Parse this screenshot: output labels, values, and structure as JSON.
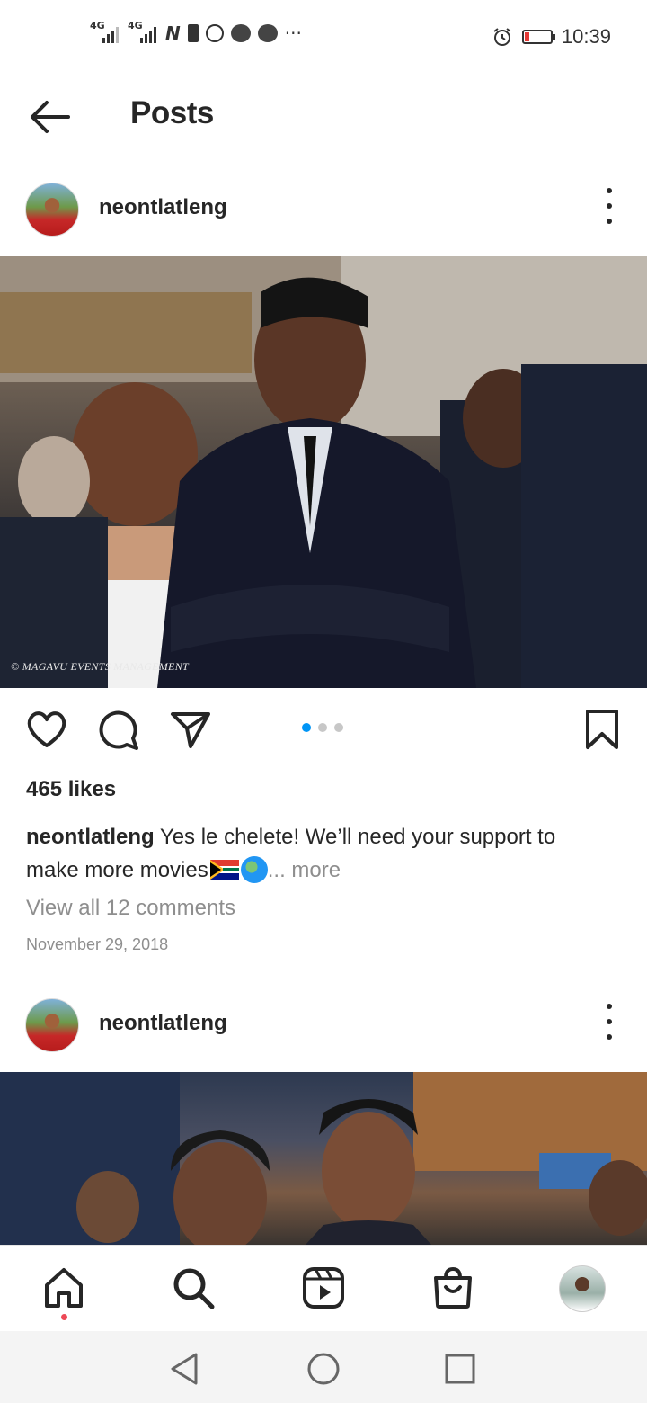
{
  "status_bar": {
    "network1": "4G",
    "network2": "4G",
    "time": "10:39",
    "icons": [
      "signal-icon",
      "signal-icon",
      "nfc-icon",
      "sim-icon",
      "whatsapp-icon",
      "chat-icon",
      "messages-icon",
      "more-notifications-icon",
      "alarm-icon",
      "battery-icon"
    ],
    "ellipsis": "···"
  },
  "header": {
    "title": "Posts",
    "back_icon": "arrow-left-icon"
  },
  "posts": [
    {
      "username": "neontlatleng",
      "watermark": "© MAGAVU EVENTS MANAGEMENT",
      "likes": "465 likes",
      "caption_user": "neontlatleng",
      "caption_text": " Yes le chelete! We’ll need your support to make more movies",
      "caption_more": "... more",
      "view_comments": "View all 12 comments",
      "date": "November 29, 2018",
      "carousel_count": 3,
      "carousel_active": 1
    },
    {
      "username": "neontlatleng"
    }
  ],
  "actions": {
    "like_icon": "heart-icon",
    "comment_icon": "comment-icon",
    "share_icon": "send-icon",
    "save_icon": "bookmark-icon"
  },
  "bottom_nav": {
    "items": [
      "home-icon",
      "search-icon",
      "reels-icon",
      "shop-icon",
      "profile-avatar"
    ]
  },
  "system_nav": {
    "items": [
      "back-triangle-icon",
      "home-circle-icon",
      "recents-square-icon"
    ]
  },
  "colors": {
    "accent": "#0095f6",
    "text": "#262626",
    "muted": "#8e8e8e",
    "notification": "#ed4956"
  }
}
